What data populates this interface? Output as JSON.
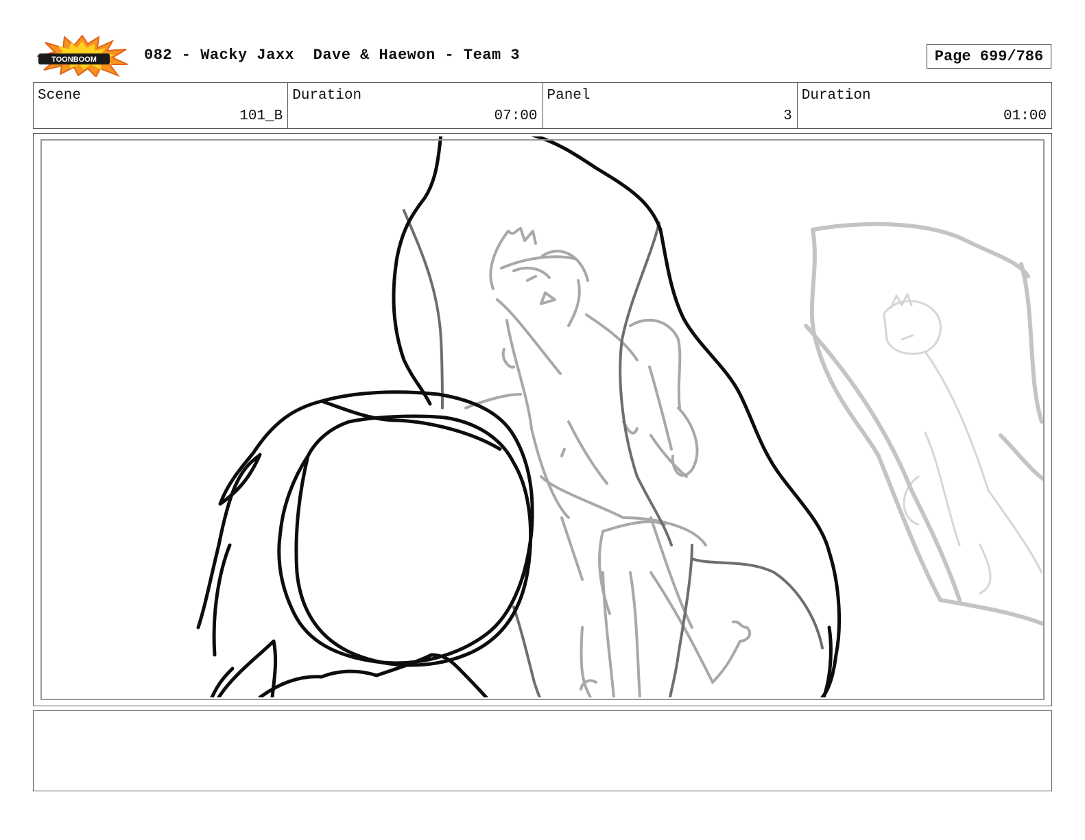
{
  "header": {
    "logo_text": "TOONBOOM",
    "title": "082 - Wacky Jaxx  Dave & Haewon - Team 3",
    "page": "Page 699/786"
  },
  "info": {
    "scene_label": "Scene",
    "scene_value": "101_B",
    "scene_duration_label": "Duration",
    "scene_duration_value": "07:00",
    "panel_label": "Panel",
    "panel_value": "3",
    "panel_duration_label": "Duration",
    "panel_duration_value": "01:00"
  },
  "notes": {
    "text": ""
  }
}
